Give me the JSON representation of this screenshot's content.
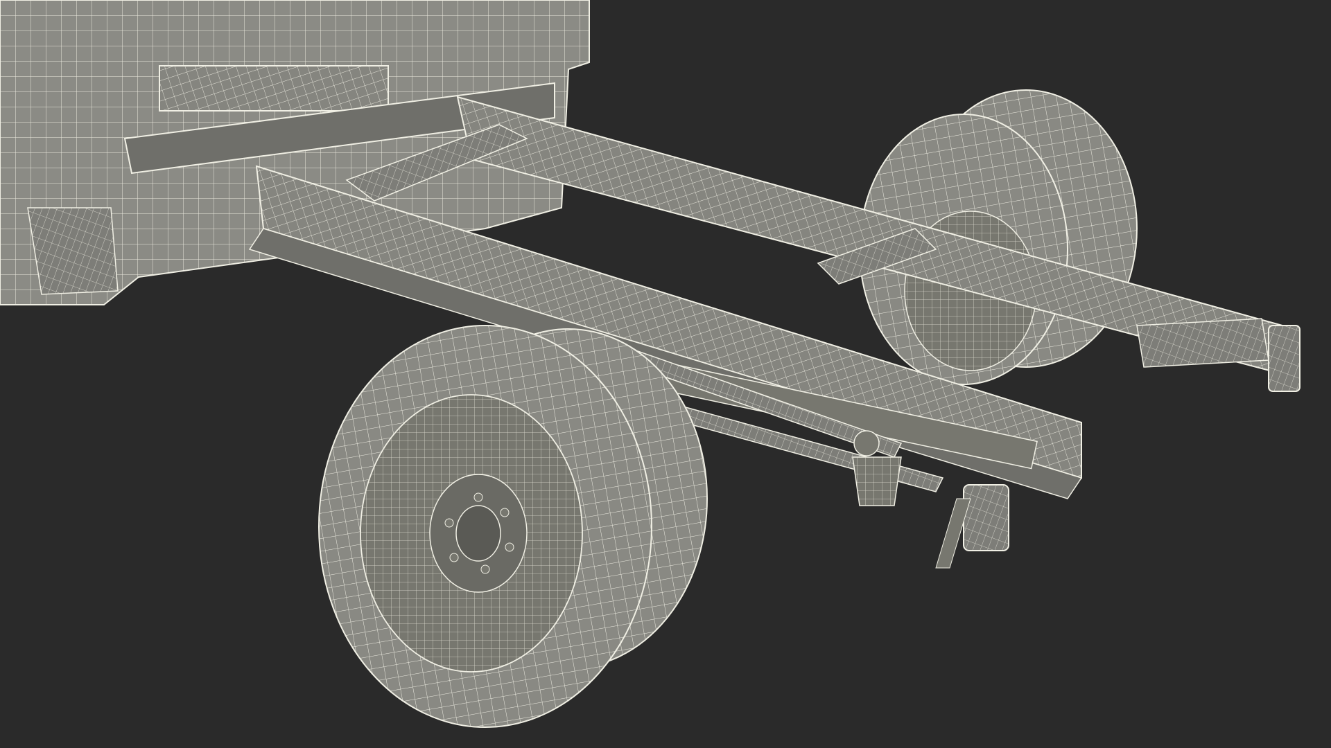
{
  "scene": {
    "background_color": "#2a2a2a",
    "mesh_fill": "#8b8b85",
    "mesh_fill_dark": "#6f6f6a",
    "wire_color": "#e6e6dc",
    "wire_dark": "#4a4a46",
    "subject": "truck-chassis-wireframe-render"
  }
}
